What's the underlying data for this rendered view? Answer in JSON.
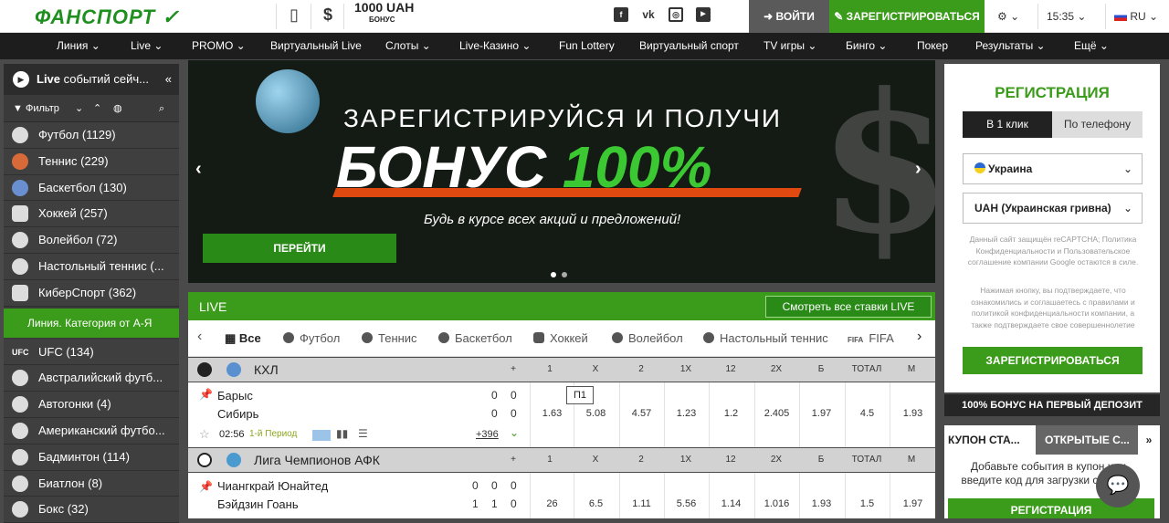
{
  "header": {
    "logo": "ФАНСПОРТ",
    "bonus_amount": "1000 UAH",
    "bonus_label": "БОНУС",
    "login_label": "ВОЙТИ",
    "register_label": "ЗАРЕГИСТРИРОВАТЬСЯ",
    "time": "15:35",
    "language": "RU",
    "social": [
      "f",
      "vk",
      "ig",
      "yt"
    ]
  },
  "nav": [
    "Линия",
    "Live",
    "PROMO",
    "Виртуальный Live",
    "Слоты",
    "Live-Казино",
    "Fun Lottery",
    "Виртуальный спорт",
    "TV игры",
    "Бинго",
    "Покер",
    "Результаты",
    "Ещё"
  ],
  "sidebar": {
    "live_label": "Live",
    "live_text": "событий сейч...",
    "filter_label": "Фильтр",
    "items_top": [
      {
        "label": "Футбол (1129)",
        "icon": "football-icon"
      },
      {
        "label": "Теннис (229)",
        "icon": "tennis-icon"
      },
      {
        "label": "Баскетбол (130)",
        "icon": "basketball-icon"
      },
      {
        "label": "Хоккей (257)",
        "icon": "hockey-icon"
      },
      {
        "label": "Волейбол (72)",
        "icon": "volleyball-icon"
      },
      {
        "label": "Настольный теннис (...",
        "icon": "table-tennis-icon"
      },
      {
        "label": "КиберСпорт (362)",
        "icon": "gamepad-icon"
      }
    ],
    "category_label": "Линия. Категория от А-Я",
    "items_bottom": [
      {
        "label": "UFC (134)",
        "icon": "ufc-icon"
      },
      {
        "label": "Австралийский футб...",
        "icon": "aussie-football-icon"
      },
      {
        "label": "Автогонки (4)",
        "icon": "steering-wheel-icon"
      },
      {
        "label": "Американский футбо...",
        "icon": "american-football-icon"
      },
      {
        "label": "Бадминтон (114)",
        "icon": "shuttlecock-icon"
      },
      {
        "label": "Биатлон (8)",
        "icon": "biathlon-icon"
      },
      {
        "label": "Бокс (32)",
        "icon": "boxing-icon"
      }
    ]
  },
  "banner": {
    "line1": "ЗАРЕГИСТРИРУЙСЯ И ПОЛУЧИ",
    "line2_white": "БОНУС ",
    "line2_green": "100%",
    "line3": "Будь в курсе всех акций и предложений!",
    "button": "ПЕРЕЙТИ"
  },
  "live": {
    "title": "LIVE",
    "all_bets": "Смотреть все ставки LIVE",
    "tabs": [
      "Все",
      "Футбол",
      "Теннис",
      "Баскетбол",
      "Хоккей",
      "Волейбол",
      "Настольный теннис",
      "FIFA"
    ]
  },
  "leagues": [
    {
      "name": "КХЛ",
      "headers": [
        "+",
        "1",
        "X",
        "2",
        "1X",
        "12",
        "2X",
        "Б",
        "ТОТАЛ",
        "М"
      ],
      "match": {
        "team1": "Барыс",
        "team2": "Сибирь",
        "score1": [
          "0",
          "0"
        ],
        "score2": [
          "0",
          "0"
        ],
        "time": "02:56",
        "period": "1-й Период",
        "markets": "+396",
        "tooltip": "П1",
        "odds": [
          "1.63",
          "5.08",
          "4.57",
          "1.23",
          "1.2",
          "2.405",
          "1.97",
          "4.5",
          "1.93"
        ]
      }
    },
    {
      "name": "Лига Чемпионов АФК",
      "headers": [
        "+",
        "1",
        "X",
        "2",
        "1X",
        "12",
        "2X",
        "Б",
        "ТОТАЛ",
        "М"
      ],
      "match": {
        "team1": "Чиангкрай Юнайтед",
        "team2": "Бэйдзин Гоань",
        "score1": [
          "0",
          "0",
          "0"
        ],
        "score2": [
          "1",
          "1",
          "0"
        ],
        "odds": [
          "26",
          "6.5",
          "1.11",
          "5.56",
          "1.14",
          "1.016",
          "1.93",
          "1.5",
          "1.97"
        ]
      }
    }
  ],
  "registration": {
    "title": "РЕГИСТРАЦИЯ",
    "tab_oneclick": "В 1 клик",
    "tab_phone": "По телефону",
    "country": "Украина",
    "currency": "UAH (Украинская гривна)",
    "note1": "Данный сайт защищён reCAPTCHA; Политика Конфиденциальности и Пользовательское соглашение компании Google остаются в силе.",
    "note2": "Нажимая кнопку, вы подтверждаете, что ознакомились и соглашаетесь с правилами и политикой конфиденциальности компании, а также подтверждаете свое совершеннолетие",
    "button": "ЗАРЕГИСТРИРОВАТЬСЯ",
    "bonus_strip": "100% БОНУС НА ПЕРВЫЙ ДЕПОЗИТ"
  },
  "coupon": {
    "tab1": "КУПОН СТА...",
    "tab2": "ОТКРЫТЫЕ С...",
    "text": "Добавьте события в купон или введите код для загрузки событий",
    "button": "РЕГИСТРАЦИЯ"
  },
  "colors": {
    "brand_green": "#3b9b1a",
    "dark": "#1d1d1d",
    "accent_orange": "#e04a10"
  }
}
